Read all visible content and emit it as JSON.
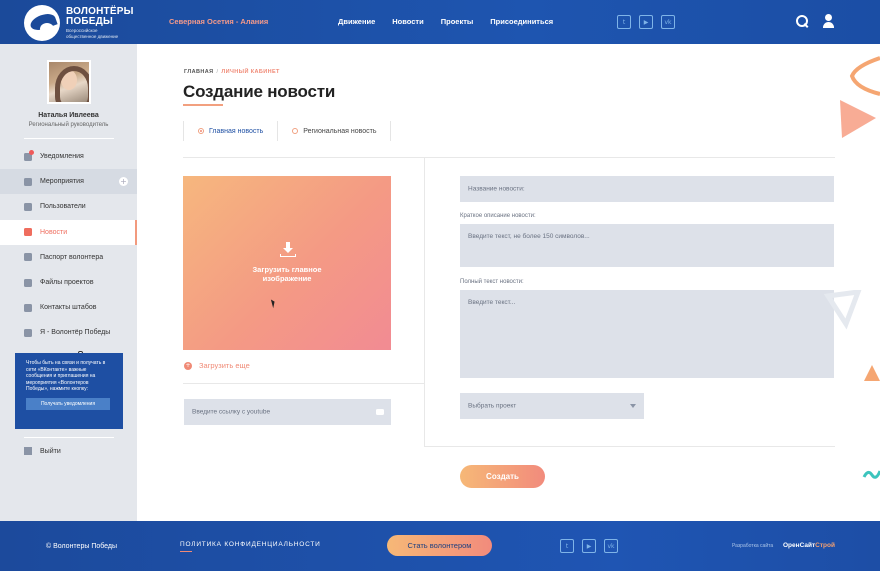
{
  "header": {
    "logo_title_1": "ВОЛОНТЁРЫ",
    "logo_title_2": "ПОБЕДЫ",
    "logo_sub_1": "Всероссийское",
    "logo_sub_2": "общественное движение",
    "region": "Северная Осетия - Алания",
    "nav": [
      "Движение",
      "Новости",
      "Проекты",
      "Присоединиться"
    ],
    "socials": [
      "twitter-icon",
      "youtube-icon",
      "vk-icon"
    ]
  },
  "sidebar": {
    "user_name": "Наталья Ивлеева",
    "user_role": "Региональный руководитель",
    "items": [
      {
        "label": "Уведомления",
        "icon": "bell-icon"
      },
      {
        "label": "Мероприятия",
        "icon": "calendar-icon"
      },
      {
        "label": "Пользователи",
        "icon": "users-icon"
      },
      {
        "label": "Новости",
        "icon": "news-icon"
      },
      {
        "label": "Паспорт волонтера",
        "icon": "passport-icon"
      },
      {
        "label": "Файлы проектов",
        "icon": "files-icon"
      },
      {
        "label": "Контакты штабов",
        "icon": "contacts-icon"
      },
      {
        "label": "Я - Волонтёр Победы",
        "icon": "flag-icon"
      }
    ],
    "promo_text": "Чтобы быть на связи и получать в сети «ВКонтакте» важные сообщения и приглашения на мероприятия «Волонтеров Победы», нажмите кнопку:",
    "promo_button": "Получать уведомления",
    "logout": "Выйти"
  },
  "main": {
    "breadcrumb": {
      "home": "ГЛАВНАЯ",
      "sep": "/",
      "current": "ЛИЧНЫЙ КАБИНЕТ"
    },
    "title": "Создание новости",
    "radio_options": [
      {
        "label": "Главная новость",
        "checked": true
      },
      {
        "label": "Региональная новость",
        "checked": false
      }
    ],
    "upload_label": "Загрузить главное изображение",
    "upload_more": "Загрузить еще",
    "youtube_placeholder": "Введите ссылку с youtube",
    "news_title_placeholder": "Название новости:",
    "short_desc_label": "Краткое описание новости:",
    "short_desc_placeholder": "Введите текст, не более 150 символов...",
    "full_text_label": "Полный текст новости:",
    "full_text_placeholder": "Введите текст...",
    "project_select": "Выбрать проект",
    "create_button": "Создать"
  },
  "footer": {
    "copyright": "© Волонтеры Победы",
    "policy": "ПОЛИТИКА КОНФИДЕНЦИАЛЬНОСТИ",
    "become_volunteer": "Стать волонтером",
    "developer_label": "Разработка сайта",
    "developer_1": "ОренСайт",
    "developer_2": "Строй"
  },
  "colors": {
    "primary": "#1e4fa3",
    "accent": "#f08a76",
    "field_bg": "#dde1e9",
    "sidebar_bg": "#e4e7ec"
  }
}
